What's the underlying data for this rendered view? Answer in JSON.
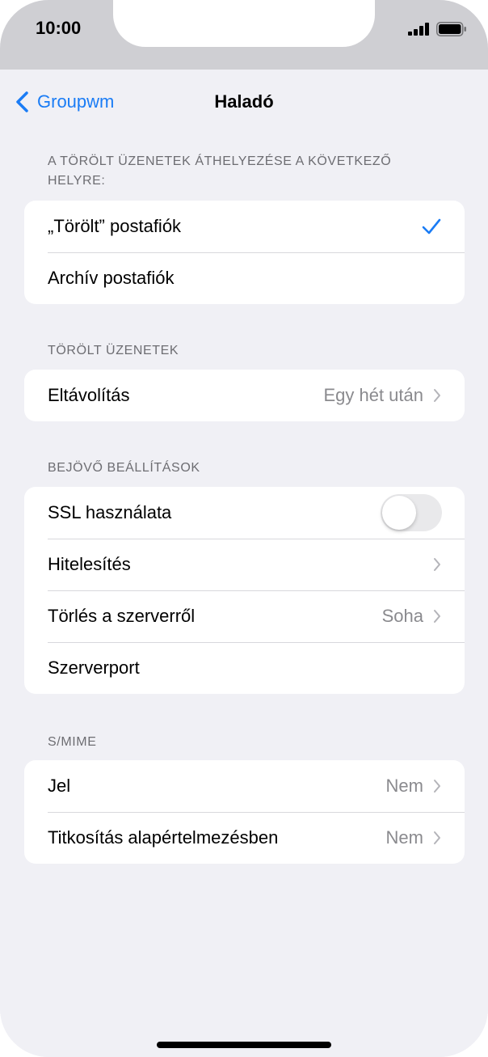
{
  "status_bar": {
    "time": "10:00"
  },
  "nav": {
    "back_label": "Groupwm",
    "title": "Haladó"
  },
  "sections": {
    "move_deleted": {
      "header": "A TÖRÖLT ÜZENETEK ÁTHELYEZÉSE A KÖVETKEZŐ HELYRE:",
      "rows": [
        {
          "label": "„Törölt” postafiók",
          "selected": true
        },
        {
          "label": "Archív postafiók",
          "selected": false
        }
      ]
    },
    "deleted_messages": {
      "header": "TÖRÖLT ÜZENETEK",
      "rows": [
        {
          "label": "Eltávolítás",
          "value": "Egy hét után"
        }
      ]
    },
    "incoming": {
      "header": "BEJÖVŐ BEÁLLÍTÁSOK",
      "rows": [
        {
          "label": "SSL használata",
          "toggle_on": false
        },
        {
          "label": "Hitelesítés",
          "value": ""
        },
        {
          "label": "Törlés a szerverről",
          "value": "Soha"
        },
        {
          "label": "Szerverport",
          "value": ""
        }
      ]
    },
    "smime": {
      "header": "S/MIME",
      "rows": [
        {
          "label": "Jel",
          "value": "Nem"
        },
        {
          "label": "Titkosítás alapértelmezésben",
          "value": "Nem"
        }
      ]
    }
  },
  "colors": {
    "accent": "#1a7cf5",
    "background": "#f0f0f5",
    "secondary_text": "#8a8a8e",
    "section_header": "#6d6d72"
  },
  "icons": [
    "signal-icon",
    "battery-icon",
    "back-chevron-icon",
    "checkmark-icon",
    "chevron-right-icon"
  ]
}
